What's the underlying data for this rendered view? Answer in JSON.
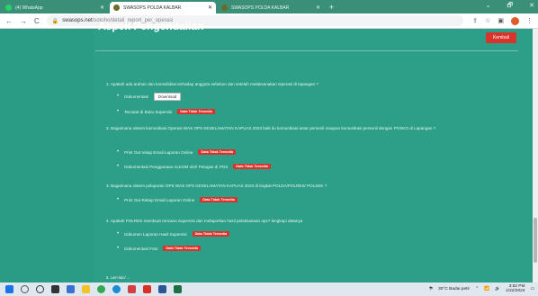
{
  "browser": {
    "tabs": [
      {
        "label": "(4) WhatsApp",
        "icon": "whatsapp-icon",
        "color": "#25d366",
        "active": false
      },
      {
        "label": "SWASOPS POLDA KALBAR",
        "icon": "police-icon",
        "color": "#6b6b2a",
        "active": true
      },
      {
        "label": "SWASOPS POLDA KALBAR",
        "icon": "police-icon",
        "color": "#6b6b2a",
        "active": false
      }
    ],
    "new_tab": "+",
    "window_controls": {
      "minimize": "⌄",
      "restore": "🗗",
      "close": "✕"
    },
    "nav": {
      "back": "←",
      "forward": "→",
      "reload": "C"
    },
    "url_host": "swasops.net",
    "url_path": "/sotoho/detail_report_per_operasi"
  },
  "page": {
    "title": "Aspek Pengendalian",
    "back_button": "Kembali",
    "questions": [
      {
        "text": "1. Apakah ada arahan dan konsolidasi terhadap anggota sebelum dan setelah melaksanakan Operasi di lapangan ?",
        "items": [
          {
            "label": "Dokumentasi",
            "type": "button",
            "value": "Download"
          },
          {
            "label": "Tercatat di Buku Supervisi",
            "type": "badge",
            "value": "Data Tidak Tersedia"
          }
        ]
      },
      {
        "text": "2. Bagaimana sistem komunikasi Operasi WAS OPS KESELAMATAN KAPUAS 2023 baik itu komunikasi antar personil maupun komunikasi personil dengan POSKO di Lapangan ?",
        "items": [
          {
            "label": "Print Out rekap Email Laporan Online",
            "type": "badge",
            "value": "Data Tidak Tersedia"
          },
          {
            "label": "Dokumentasi Penggunaan ALKOM oleh Petugas di POS",
            "type": "badge",
            "value": "Data Tidak Tersedia"
          }
        ]
      },
      {
        "text": "3. Bagaimana sistem pelaporan OPS WAS OPS KESELAMATAN KAPUAS 2023 di tingkat POLDA/POLRES/ POLSEK ?",
        "items": [
          {
            "label": "Print Out Rekap Email Laporan Online",
            "type": "badge",
            "value": "Data Tidak Tersedia"
          }
        ]
      },
      {
        "text": "4. Apakah POLRES membuat rencana Supervisi dan melaporkan hasil pelaksanaan ops? lengkapi datanya",
        "items": [
          {
            "label": "Dokumen Laporan Hasil Supervisi",
            "type": "badge",
            "value": "Data Tidak Tersedia"
          },
          {
            "label": "Dokumentasi Foto",
            "type": "badge",
            "value": "Data Tidak Tersedia"
          }
        ]
      }
    ],
    "footer_text": "5. Lain-lain/ ..."
  },
  "taskbar": {
    "apps": [
      {
        "name": "windows-start-icon",
        "color": "#1a73e8"
      },
      {
        "name": "search-icon",
        "color": "#555555"
      },
      {
        "name": "circle-icon",
        "color": "#333333"
      },
      {
        "name": "task-view-icon",
        "color": "#333333"
      },
      {
        "name": "widgets-icon",
        "color": "#3b6fd1"
      },
      {
        "name": "file-explorer-icon",
        "color": "#f5c02a"
      },
      {
        "name": "chrome-icon",
        "color": "#34a853"
      },
      {
        "name": "edge-icon",
        "color": "#1b8ad7"
      },
      {
        "name": "app-icon",
        "color": "#d04040"
      },
      {
        "name": "pdf-icon",
        "color": "#d93025"
      },
      {
        "name": "word-icon",
        "color": "#2b5797"
      },
      {
        "name": "excel-icon",
        "color": "#1d7044"
      }
    ],
    "weather": "30°C  Badai petir",
    "time": "3:52 PM",
    "date": "1/22/2024"
  }
}
